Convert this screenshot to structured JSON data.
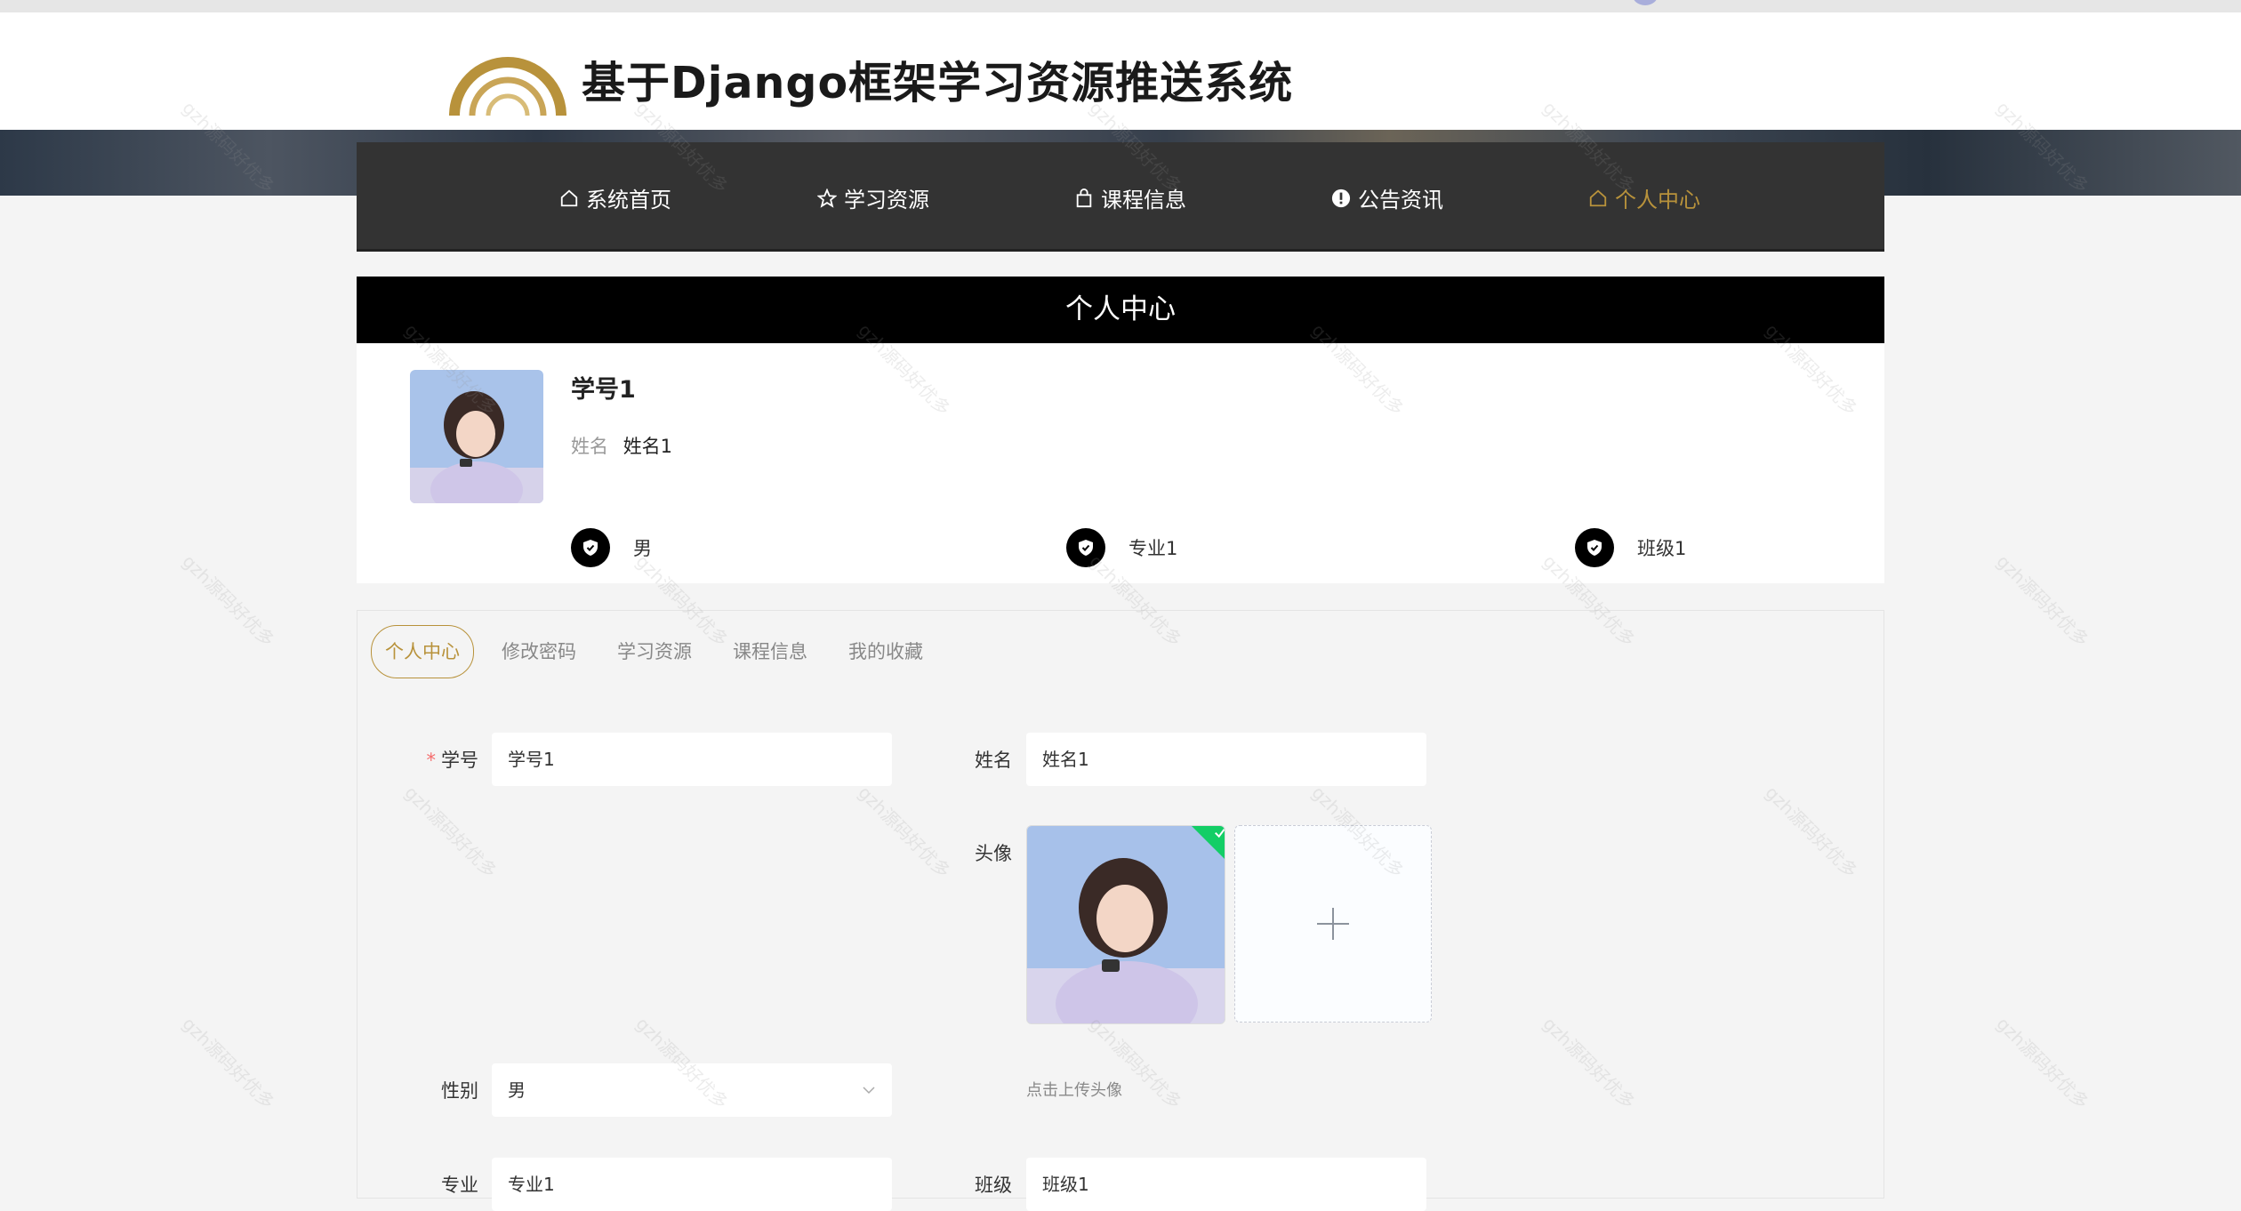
{
  "site": {
    "title": "基于Django框架学习资源推送系统"
  },
  "nav": [
    {
      "label": "系统首页",
      "icon": "home-icon"
    },
    {
      "label": "学习资源",
      "icon": "star-icon"
    },
    {
      "label": "课程信息",
      "icon": "bag-icon"
    },
    {
      "label": "公告资讯",
      "icon": "info-icon"
    },
    {
      "label": "个人中心",
      "icon": "home-icon",
      "active": true
    }
  ],
  "page_title": "个人中心",
  "profile": {
    "username": "学号1",
    "name_label": "姓名",
    "name_value": "姓名1",
    "badges": [
      "男",
      "专业1",
      "班级1"
    ]
  },
  "tabs": [
    "个人中心",
    "修改密码",
    "学习资源",
    "课程信息",
    "我的收藏"
  ],
  "form": {
    "student_id_label": "学号",
    "student_id_value": "学号1",
    "name_label": "姓名",
    "name_value": "姓名1",
    "avatar_label": "头像",
    "avatar_hint": "点击上传头像",
    "gender_label": "性别",
    "gender_value": "男",
    "major_label": "专业",
    "major_value": "专业1",
    "class_label": "班级",
    "class_value": "班级1"
  },
  "colors": {
    "accent": "#b8923b",
    "nav_bg": "#333333",
    "success": "#13ce66"
  },
  "watermark": "gzh源码好优多"
}
